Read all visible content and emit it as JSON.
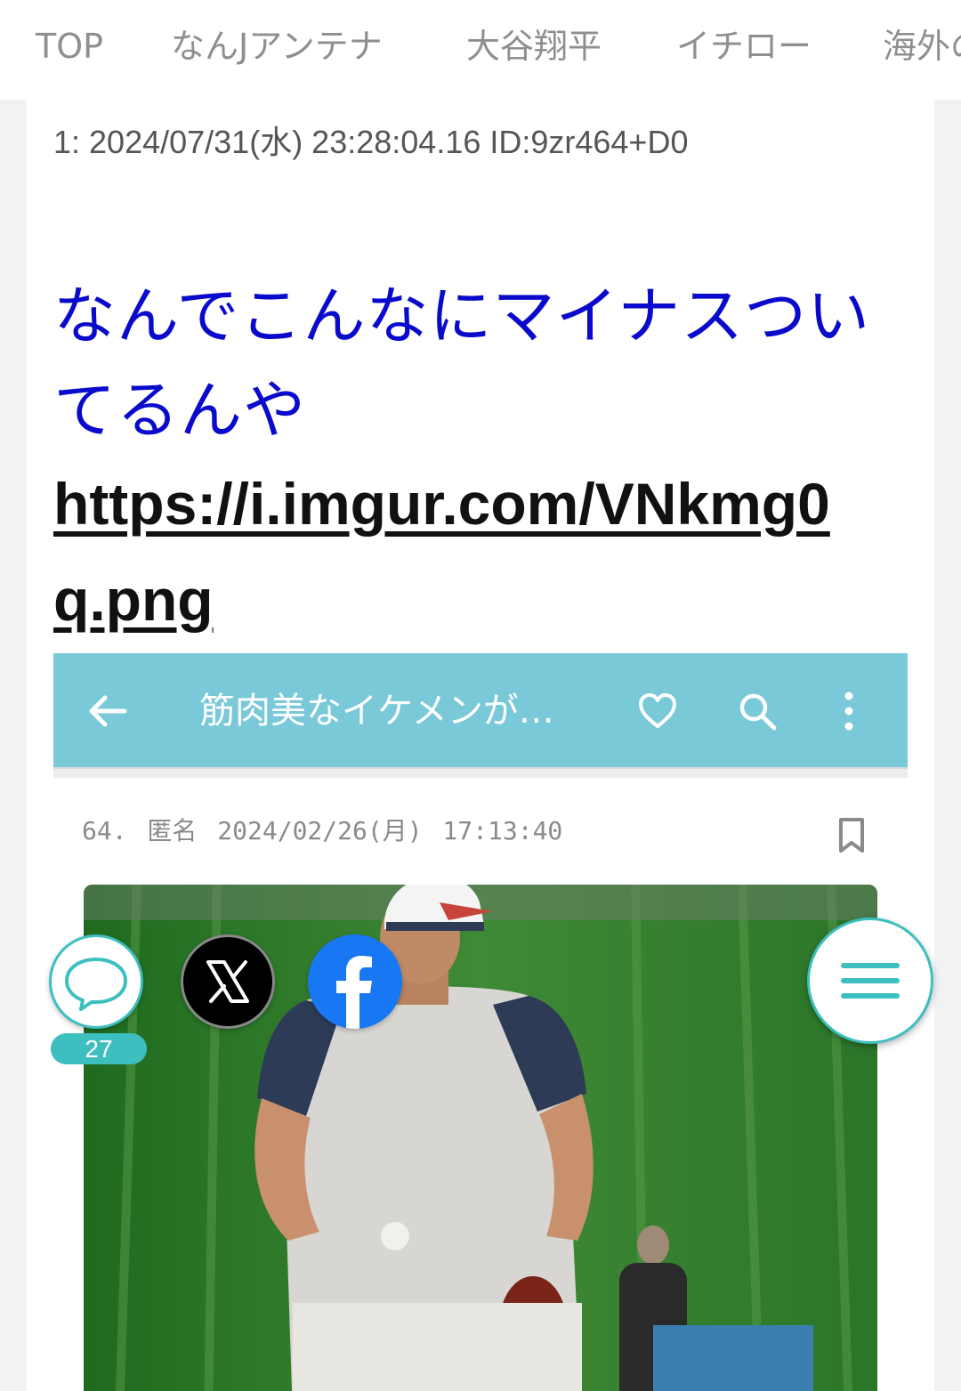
{
  "nav": {
    "items": [
      "TOP",
      "なんJアンテナ",
      "大谷翔平",
      "イチロー",
      "海外の"
    ]
  },
  "post": {
    "meta": "1: 2024/07/31(水) 23:28:04.16 ID:9zr464+D0",
    "text_line1": "なんでこんなにマイナスつい",
    "text_line2": "てるんや",
    "link_line1": "https://i.imgur.com/VNkmg0",
    "link_line2": "q.png"
  },
  "embed": {
    "title": "筋肉美なイケメンが…",
    "meta": "64. 匿名 2024/02/26(月) 17:13:40",
    "bar_color": "#79c9d8",
    "icons": [
      "back-arrow-icon",
      "heart-icon",
      "search-icon",
      "more-vert-icon",
      "bookmark-icon"
    ]
  },
  "floating": {
    "comment_count": "27",
    "icons": [
      "comment-icon",
      "x-logo-icon",
      "facebook-icon",
      "menu-icon"
    ],
    "accent": "#3dbfbf"
  }
}
